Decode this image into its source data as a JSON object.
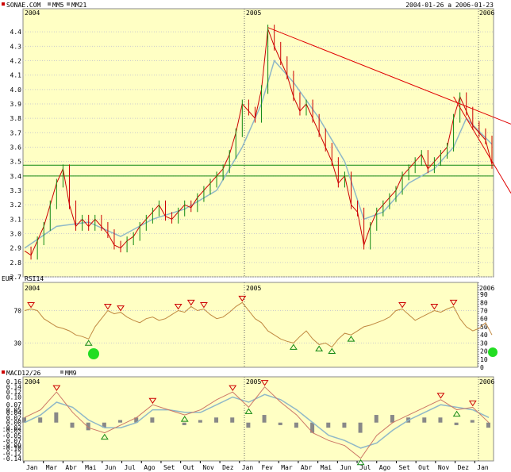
{
  "chart_data": [
    {
      "type": "line",
      "title": "SONAE.COM",
      "legend": [
        {
          "name": "SONAE.COM",
          "color": "#cc0000"
        },
        {
          "name": "MM5",
          "color": "#888888"
        },
        {
          "name": "MM21",
          "color": "#888888"
        }
      ],
      "date_range": "2004-01-26 a 2006-01-23",
      "year_labels": [
        "2004",
        "2005",
        "2006"
      ],
      "y_ticks": [
        "4.4",
        "4.3",
        "4.2",
        "4.1",
        "4.0",
        "3.9",
        "3.8",
        "3.7",
        "3.6",
        "3.5",
        "3.4",
        "3.3",
        "3.2",
        "3.1",
        "3.0",
        "2.9",
        "2.8",
        "2.7"
      ],
      "ylim": [
        2.7,
        4.5
      ],
      "x_ticks": [
        "Jan",
        "Mar",
        "Abr",
        "Mai",
        "Jun",
        "Jul",
        "Ago",
        "Set",
        "Out",
        "Nov",
        "Dez",
        "Jan",
        "Fev",
        "Mar",
        "Abr",
        "Mai",
        "Jun",
        "Jul",
        "Ago",
        "Set",
        "Out",
        "Nov",
        "Dez",
        "Jan"
      ],
      "close_series": [
        [
          0,
          2.88
        ],
        [
          4,
          2.85
        ],
        [
          8,
          2.95
        ],
        [
          12,
          3.05
        ],
        [
          16,
          3.2
        ],
        [
          20,
          3.35
        ],
        [
          24,
          3.45
        ],
        [
          28,
          3.2
        ],
        [
          32,
          3.05
        ],
        [
          36,
          3.1
        ],
        [
          40,
          3.05
        ],
        [
          44,
          3.1
        ],
        [
          48,
          3.05
        ],
        [
          52,
          3.0
        ],
        [
          56,
          2.92
        ],
        [
          60,
          2.9
        ],
        [
          64,
          2.95
        ],
        [
          68,
          2.98
        ],
        [
          72,
          3.05
        ],
        [
          76,
          3.1
        ],
        [
          80,
          3.15
        ],
        [
          84,
          3.2
        ],
        [
          88,
          3.12
        ],
        [
          92,
          3.1
        ],
        [
          96,
          3.15
        ],
        [
          100,
          3.2
        ],
        [
          104,
          3.18
        ],
        [
          108,
          3.25
        ],
        [
          112,
          3.3
        ],
        [
          116,
          3.35
        ],
        [
          120,
          3.4
        ],
        [
          124,
          3.45
        ],
        [
          128,
          3.55
        ],
        [
          132,
          3.7
        ],
        [
          136,
          3.9
        ],
        [
          140,
          3.85
        ],
        [
          144,
          3.8
        ],
        [
          148,
          4.0
        ],
        [
          152,
          4.42
        ],
        [
          156,
          4.3
        ],
        [
          160,
          4.2
        ],
        [
          164,
          4.1
        ],
        [
          168,
          3.95
        ],
        [
          172,
          3.85
        ],
        [
          176,
          3.9
        ],
        [
          180,
          3.8
        ],
        [
          184,
          3.7
        ],
        [
          188,
          3.6
        ],
        [
          192,
          3.5
        ],
        [
          196,
          3.35
        ],
        [
          200,
          3.4
        ],
        [
          204,
          3.2
        ],
        [
          208,
          3.15
        ],
        [
          212,
          2.92
        ],
        [
          216,
          3.05
        ],
        [
          220,
          3.15
        ],
        [
          224,
          3.2
        ],
        [
          228,
          3.25
        ],
        [
          232,
          3.3
        ],
        [
          236,
          3.4
        ],
        [
          240,
          3.45
        ],
        [
          244,
          3.5
        ],
        [
          248,
          3.55
        ],
        [
          252,
          3.45
        ],
        [
          256,
          3.5
        ],
        [
          260,
          3.55
        ],
        [
          264,
          3.6
        ],
        [
          268,
          3.8
        ],
        [
          272,
          3.95
        ],
        [
          276,
          3.85
        ],
        [
          280,
          3.75
        ],
        [
          284,
          3.7
        ],
        [
          288,
          3.65
        ],
        [
          292,
          3.48
        ]
      ],
      "ma21_series": [
        [
          0,
          2.9
        ],
        [
          20,
          3.05
        ],
        [
          40,
          3.08
        ],
        [
          60,
          2.98
        ],
        [
          80,
          3.1
        ],
        [
          100,
          3.17
        ],
        [
          120,
          3.3
        ],
        [
          136,
          3.6
        ],
        [
          148,
          3.9
        ],
        [
          156,
          4.2
        ],
        [
          168,
          4.05
        ],
        [
          184,
          3.8
        ],
        [
          200,
          3.5
        ],
        [
          212,
          3.1
        ],
        [
          224,
          3.15
        ],
        [
          240,
          3.35
        ],
        [
          256,
          3.45
        ],
        [
          268,
          3.6
        ],
        [
          276,
          3.8
        ],
        [
          292,
          3.62
        ]
      ],
      "resistance_line": {
        "x": [
          152,
          292
        ],
        "y": [
          4.43,
          3.8
        ]
      },
      "support_lines": [
        3.475,
        3.4
      ]
    },
    {
      "type": "line",
      "title": "RSI14",
      "year_labels": [
        "2004",
        "2005",
        "2006"
      ],
      "y_ticks": [
        "90",
        "80",
        "70",
        "60",
        "50",
        "40",
        "30",
        "20",
        "10",
        "0"
      ],
      "left_ticks": [
        "70",
        "30"
      ],
      "ylim": [
        0,
        95
      ],
      "series": [
        [
          0,
          70
        ],
        [
          4,
          72
        ],
        [
          8,
          70
        ],
        [
          12,
          60
        ],
        [
          16,
          55
        ],
        [
          20,
          50
        ],
        [
          24,
          48
        ],
        [
          28,
          45
        ],
        [
          32,
          40
        ],
        [
          36,
          38
        ],
        [
          40,
          35
        ],
        [
          44,
          50
        ],
        [
          48,
          60
        ],
        [
          52,
          70
        ],
        [
          56,
          66
        ],
        [
          60,
          68
        ],
        [
          64,
          62
        ],
        [
          68,
          58
        ],
        [
          72,
          55
        ],
        [
          76,
          60
        ],
        [
          80,
          62
        ],
        [
          84,
          58
        ],
        [
          88,
          60
        ],
        [
          92,
          65
        ],
        [
          96,
          70
        ],
        [
          100,
          68
        ],
        [
          104,
          75
        ],
        [
          108,
          70
        ],
        [
          112,
          72
        ],
        [
          116,
          65
        ],
        [
          120,
          60
        ],
        [
          124,
          62
        ],
        [
          128,
          68
        ],
        [
          132,
          75
        ],
        [
          136,
          80
        ],
        [
          140,
          70
        ],
        [
          144,
          60
        ],
        [
          148,
          55
        ],
        [
          152,
          45
        ],
        [
          156,
          40
        ],
        [
          160,
          35
        ],
        [
          164,
          32
        ],
        [
          168,
          30
        ],
        [
          172,
          38
        ],
        [
          176,
          45
        ],
        [
          180,
          35
        ],
        [
          184,
          28
        ],
        [
          188,
          30
        ],
        [
          192,
          25
        ],
        [
          196,
          35
        ],
        [
          200,
          42
        ],
        [
          204,
          40
        ],
        [
          208,
          45
        ],
        [
          212,
          50
        ],
        [
          216,
          52
        ],
        [
          220,
          55
        ],
        [
          224,
          58
        ],
        [
          228,
          62
        ],
        [
          232,
          70
        ],
        [
          236,
          72
        ],
        [
          240,
          65
        ],
        [
          244,
          58
        ],
        [
          248,
          62
        ],
        [
          252,
          66
        ],
        [
          256,
          70
        ],
        [
          260,
          68
        ],
        [
          264,
          72
        ],
        [
          268,
          75
        ],
        [
          272,
          60
        ],
        [
          276,
          50
        ],
        [
          280,
          45
        ],
        [
          284,
          48
        ],
        [
          288,
          55
        ],
        [
          292,
          40
        ]
      ]
    },
    {
      "type": "line",
      "title": "MACD12/26",
      "legend": [
        {
          "name": "MACD12/26",
          "color": "#cc0000"
        },
        {
          "name": "MM9",
          "color": "#888888"
        }
      ],
      "year_labels": [
        "2004",
        "2005",
        "2006"
      ],
      "y_ticks": [
        "0.16",
        "0.14",
        "0.12",
        "0.10",
        "0.07",
        "0.05",
        "0.04",
        "0.02",
        "0.00",
        "-0.02",
        "-0.03",
        "-0.05",
        "-0.07",
        "-0.09",
        "-0.10",
        "-0.12",
        "-0.14"
      ],
      "ylim": [
        -0.15,
        0.17
      ],
      "macd_series": [
        [
          0,
          0.02
        ],
        [
          10,
          0.05
        ],
        [
          20,
          0.12
        ],
        [
          30,
          0.04
        ],
        [
          40,
          -0.02
        ],
        [
          50,
          -0.04
        ],
        [
          60,
          -0.01
        ],
        [
          70,
          0.02
        ],
        [
          80,
          0.07
        ],
        [
          90,
          0.05
        ],
        [
          100,
          0.03
        ],
        [
          110,
          0.05
        ],
        [
          120,
          0.09
        ],
        [
          130,
          0.12
        ],
        [
          140,
          0.06
        ],
        [
          150,
          0.14
        ],
        [
          160,
          0.08
        ],
        [
          170,
          0.03
        ],
        [
          180,
          -0.04
        ],
        [
          190,
          -0.07
        ],
        [
          200,
          -0.09
        ],
        [
          210,
          -0.14
        ],
        [
          220,
          -0.05
        ],
        [
          230,
          0.0
        ],
        [
          240,
          0.03
        ],
        [
          250,
          0.06
        ],
        [
          260,
          0.09
        ],
        [
          270,
          0.05
        ],
        [
          280,
          0.06
        ],
        [
          290,
          0.0
        ]
      ],
      "signal_series": [
        [
          0,
          0.0
        ],
        [
          10,
          0.03
        ],
        [
          20,
          0.08
        ],
        [
          30,
          0.06
        ],
        [
          40,
          0.01
        ],
        [
          50,
          -0.02
        ],
        [
          60,
          -0.02
        ],
        [
          70,
          0.0
        ],
        [
          80,
          0.05
        ],
        [
          90,
          0.05
        ],
        [
          100,
          0.04
        ],
        [
          110,
          0.04
        ],
        [
          120,
          0.07
        ],
        [
          130,
          0.1
        ],
        [
          140,
          0.08
        ],
        [
          150,
          0.11
        ],
        [
          160,
          0.09
        ],
        [
          170,
          0.05
        ],
        [
          180,
          0.0
        ],
        [
          190,
          -0.05
        ],
        [
          200,
          -0.07
        ],
        [
          210,
          -0.1
        ],
        [
          220,
          -0.08
        ],
        [
          230,
          -0.03
        ],
        [
          240,
          0.01
        ],
        [
          250,
          0.04
        ],
        [
          260,
          0.07
        ],
        [
          270,
          0.06
        ],
        [
          280,
          0.05
        ],
        [
          290,
          0.02
        ]
      ]
    }
  ]
}
